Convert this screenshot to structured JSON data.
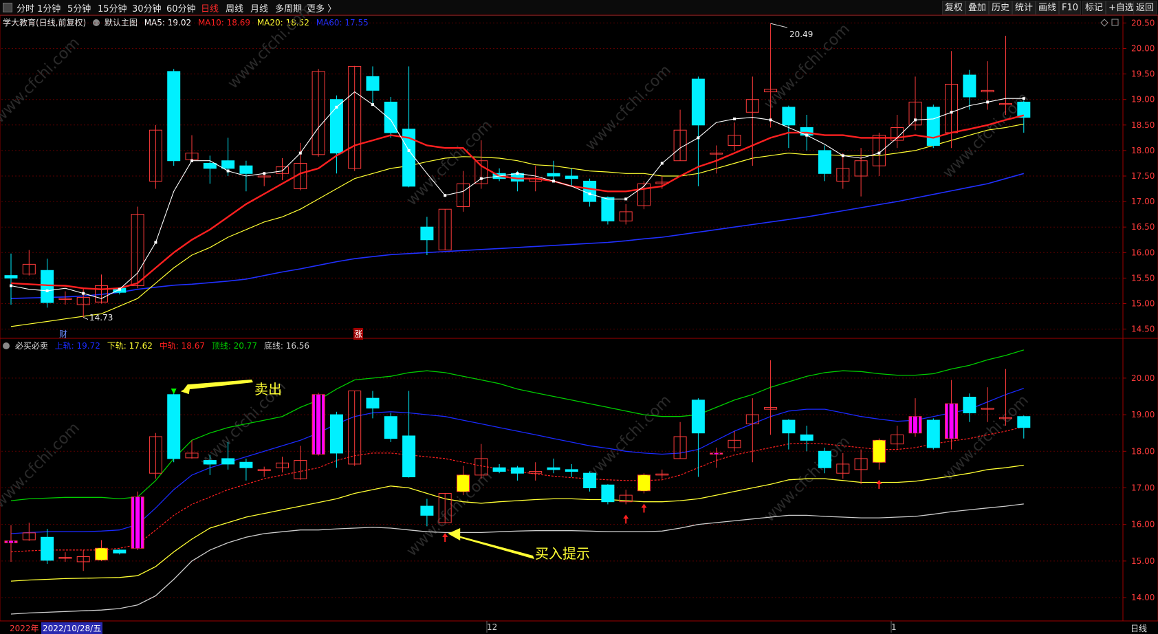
{
  "toolbar": {
    "periods": [
      "分时",
      "1分钟",
      "5分钟",
      "15分钟",
      "30分钟",
      "60分钟",
      "日线",
      "周线",
      "月线",
      "多周期",
      "更多 〉"
    ],
    "active_period": "日线",
    "buttons": [
      "复权",
      "叠加",
      "历史",
      "统计",
      "画线",
      "F10",
      "标记",
      "+自选",
      "返回"
    ]
  },
  "main_legend": {
    "stock": "学大教育(日线,前复权)",
    "template": "默认主图",
    "ma5": "MA5: 19.02",
    "ma10": "MA10: 18.69",
    "ma20": "MA20: 18.52",
    "ma60": "MA60: 17.55"
  },
  "indicator_legend": {
    "name": "必买必卖",
    "upper": "上轨: 19.72",
    "lower": "下轨: 17.62",
    "middle": "中轨: 18.67",
    "top": "顶线: 20.77",
    "bottom": "底线: 16.56"
  },
  "markers": {
    "cai": "财",
    "zhang": "涨",
    "high_label": "20.49",
    "low_label": "14.73"
  },
  "annotations": {
    "sell": "卖出",
    "buy": "买入提示"
  },
  "bottom_bar": {
    "year": "2022年",
    "date": "2022/10/28/五",
    "month12": "12",
    "month1": "1",
    "period_label": "日线"
  },
  "watermark": "www.cfchi.com",
  "colors": {
    "up": "#ff3b3b",
    "down": "#00f0ff",
    "ma5": "#ffffff",
    "ma10": "#ff2020",
    "ma20": "#ffff33",
    "ma60": "#2030ff",
    "band_top": "#00cc00",
    "band_upper": "#1a2aff",
    "band_mid": "#ff2020",
    "band_lower": "#ffff33",
    "band_bottom": "#cccccc",
    "buy_sell_pen": "#ff00ff",
    "highlight_up": "#ffff00",
    "annotation": "#ffff33"
  },
  "chart_data": [
    {
      "type": "candlestick",
      "title": "学大教育(日线,前复权)",
      "ylim": [
        14.4,
        20.6
      ],
      "y_ticks": [
        14.5,
        15.0,
        15.5,
        16.0,
        16.5,
        17.0,
        17.5,
        18.0,
        18.5,
        19.0,
        19.5,
        20.0,
        20.5
      ],
      "series_names": [
        "MA5",
        "MA10",
        "MA20",
        "MA60"
      ],
      "candles": [
        [
          15.55,
          15.5,
          15.98,
          14.98
        ],
        [
          15.58,
          15.77,
          16.05,
          15.55
        ],
        [
          15.65,
          15.02,
          15.88,
          14.92
        ],
        [
          15.08,
          15.1,
          15.24,
          14.98
        ],
        [
          14.98,
          15.12,
          15.3,
          14.73
        ],
        [
          15.03,
          15.35,
          15.57,
          15.0
        ],
        [
          15.3,
          15.22,
          15.32,
          15.18
        ],
        [
          15.35,
          16.75,
          16.9,
          15.3
        ],
        [
          17.4,
          18.4,
          18.5,
          17.25
        ],
        [
          19.55,
          17.8,
          19.6,
          17.7
        ],
        [
          17.82,
          17.95,
          18.3,
          17.8
        ],
        [
          17.75,
          17.65,
          17.9,
          17.35
        ],
        [
          17.8,
          17.65,
          18.25,
          17.5
        ],
        [
          17.7,
          17.55,
          17.8,
          17.2
        ],
        [
          17.48,
          17.5,
          17.58,
          17.3
        ],
        [
          17.55,
          17.68,
          17.85,
          17.42
        ],
        [
          17.25,
          17.75,
          18.15,
          17.22
        ],
        [
          17.92,
          19.55,
          19.6,
          17.88
        ],
        [
          19.0,
          17.95,
          19.08,
          17.55
        ],
        [
          17.65,
          19.65,
          19.66,
          17.6
        ],
        [
          19.45,
          19.18,
          19.65,
          18.9
        ],
        [
          18.95,
          18.35,
          19.05,
          18.25
        ],
        [
          18.42,
          17.3,
          19.65,
          17.28
        ],
        [
          16.5,
          16.25,
          16.7,
          15.95
        ],
        [
          16.05,
          16.85,
          16.85,
          16.05
        ],
        [
          16.9,
          17.35,
          17.6,
          16.8
        ],
        [
          17.35,
          17.8,
          18.2,
          17.25
        ],
        [
          17.55,
          17.45,
          17.65,
          17.4
        ],
        [
          17.55,
          17.4,
          17.6,
          17.2
        ],
        [
          17.4,
          17.45,
          17.7,
          17.2
        ],
        [
          17.55,
          17.5,
          17.8,
          17.4
        ],
        [
          17.5,
          17.45,
          17.65,
          17.3
        ],
        [
          17.4,
          17.0,
          17.45,
          16.9
        ],
        [
          17.08,
          16.62,
          17.1,
          16.55
        ],
        [
          16.62,
          16.8,
          16.95,
          16.55
        ],
        [
          16.92,
          17.35,
          17.4,
          16.85
        ],
        [
          17.35,
          17.38,
          17.5,
          17.25
        ],
        [
          17.8,
          18.4,
          18.8,
          17.8
        ],
        [
          19.4,
          18.5,
          19.45,
          17.3
        ],
        [
          17.95,
          17.95,
          18.1,
          17.55
        ],
        [
          18.1,
          18.3,
          18.55,
          18.0
        ],
        [
          18.75,
          19.0,
          19.45,
          17.7
        ],
        [
          19.15,
          19.2,
          20.49,
          18.45
        ],
        [
          18.85,
          18.5,
          18.88,
          18.05
        ],
        [
          18.45,
          18.3,
          18.7,
          18.0
        ],
        [
          18.0,
          17.55,
          18.1,
          17.4
        ],
        [
          17.4,
          17.65,
          17.95,
          17.25
        ],
        [
          17.5,
          17.8,
          18.05,
          17.1
        ],
        [
          17.7,
          18.3,
          18.35,
          17.5
        ],
        [
          18.2,
          18.45,
          18.7,
          18.05
        ],
        [
          18.5,
          18.95,
          19.45,
          18.4
        ],
        [
          18.85,
          18.1,
          18.9,
          18.05
        ],
        [
          18.35,
          19.3,
          19.95,
          18.05
        ],
        [
          19.48,
          19.05,
          19.58,
          18.8
        ],
        [
          19.15,
          19.18,
          19.75,
          18.8
        ],
        [
          18.92,
          18.92,
          20.25,
          18.7
        ],
        [
          18.95,
          18.65,
          18.98,
          18.35
        ]
      ],
      "ma5": [
        15.35,
        15.28,
        15.25,
        15.3,
        15.2,
        15.1,
        15.28,
        15.6,
        16.2,
        17.2,
        17.8,
        17.8,
        17.6,
        17.5,
        17.55,
        17.6,
        17.95,
        18.45,
        18.85,
        19.15,
        18.9,
        18.6,
        18.0,
        17.55,
        17.12,
        17.2,
        17.45,
        17.5,
        17.55,
        17.5,
        17.4,
        17.3,
        17.15,
        17.05,
        17.05,
        17.3,
        17.75,
        18.05,
        18.25,
        18.55,
        18.62,
        18.65,
        18.6,
        18.45,
        18.3,
        18.12,
        17.9,
        17.85,
        17.95,
        18.25,
        18.6,
        18.62,
        18.75,
        18.88,
        18.95,
        19.02,
        19.02
      ],
      "ma10": [
        15.4,
        15.38,
        15.36,
        15.35,
        15.3,
        15.28,
        15.3,
        15.4,
        15.7,
        16.0,
        16.25,
        16.45,
        16.7,
        16.95,
        17.15,
        17.35,
        17.55,
        17.65,
        17.9,
        18.1,
        18.2,
        18.3,
        18.25,
        18.1,
        18.05,
        18.05,
        17.7,
        17.5,
        17.45,
        17.45,
        17.4,
        17.3,
        17.25,
        17.2,
        17.2,
        17.25,
        17.3,
        17.5,
        17.68,
        17.8,
        17.95,
        18.1,
        18.25,
        18.35,
        18.35,
        18.3,
        18.3,
        18.25,
        18.25,
        18.25,
        18.3,
        18.25,
        18.35,
        18.42,
        18.5,
        18.6,
        18.69
      ],
      "ma20": [
        14.55,
        14.6,
        14.65,
        14.7,
        14.75,
        14.8,
        14.95,
        15.1,
        15.4,
        15.7,
        15.95,
        16.1,
        16.3,
        16.45,
        16.6,
        16.7,
        16.85,
        17.05,
        17.25,
        17.45,
        17.55,
        17.65,
        17.7,
        17.78,
        17.85,
        17.88,
        17.87,
        17.85,
        17.8,
        17.72,
        17.7,
        17.65,
        17.6,
        17.58,
        17.55,
        17.55,
        17.5,
        17.5,
        17.55,
        17.65,
        17.75,
        17.85,
        17.9,
        17.95,
        17.92,
        17.92,
        17.9,
        17.9,
        17.9,
        17.95,
        18.0,
        18.1,
        18.2,
        18.3,
        18.4,
        18.45,
        18.52
      ],
      "ma60": [
        15.1,
        15.11,
        15.12,
        15.13,
        15.15,
        15.18,
        15.22,
        15.28,
        15.32,
        15.36,
        15.38,
        15.41,
        15.44,
        15.48,
        15.55,
        15.62,
        15.68,
        15.75,
        15.82,
        15.88,
        15.92,
        15.96,
        15.98,
        16.0,
        16.02,
        16.04,
        16.06,
        16.08,
        16.1,
        16.12,
        16.14,
        16.16,
        16.18,
        16.2,
        16.23,
        16.27,
        16.3,
        16.35,
        16.4,
        16.45,
        16.5,
        16.55,
        16.6,
        16.65,
        16.7,
        16.76,
        16.82,
        16.88,
        16.94,
        17.0,
        17.07,
        17.14,
        17.21,
        17.28,
        17.35,
        17.45,
        17.55
      ]
    },
    {
      "type": "candlestick",
      "title": "必买必卖",
      "ylim": [
        13.4,
        20.9
      ],
      "y_ticks": [
        14.0,
        15.0,
        16.0,
        17.0,
        18.0,
        19.0,
        20.0
      ],
      "series_names": [
        "上轨",
        "下轨",
        "中轨",
        "顶线",
        "底线"
      ],
      "top": [
        16.65,
        16.7,
        16.72,
        16.74,
        16.74,
        16.74,
        16.7,
        16.75,
        17.2,
        17.8,
        18.3,
        18.5,
        18.65,
        18.75,
        18.85,
        18.95,
        19.2,
        19.4,
        19.7,
        19.95,
        20.0,
        20.05,
        20.15,
        20.2,
        20.15,
        20.05,
        19.95,
        19.85,
        19.7,
        19.6,
        19.5,
        19.4,
        19.3,
        19.2,
        19.1,
        19.0,
        18.95,
        18.95,
        19.0,
        19.2,
        19.4,
        19.55,
        19.75,
        19.9,
        20.05,
        20.15,
        20.2,
        20.18,
        20.12,
        20.08,
        20.08,
        20.12,
        20.25,
        20.35,
        20.5,
        20.62,
        20.77
      ],
      "upper": [
        15.75,
        15.78,
        15.8,
        15.8,
        15.8,
        15.82,
        15.85,
        16.0,
        16.45,
        16.95,
        17.35,
        17.55,
        17.7,
        17.85,
        18.0,
        18.15,
        18.3,
        18.5,
        18.75,
        18.95,
        19.05,
        19.08,
        19.05,
        19.0,
        18.95,
        18.85,
        18.75,
        18.65,
        18.55,
        18.45,
        18.35,
        18.25,
        18.15,
        18.08,
        18.0,
        17.95,
        17.92,
        17.95,
        18.05,
        18.3,
        18.55,
        18.75,
        18.95,
        19.1,
        19.15,
        19.15,
        19.05,
        18.95,
        18.88,
        18.82,
        18.85,
        18.95,
        19.05,
        19.15,
        19.35,
        19.55,
        19.72
      ],
      "middle": [
        15.25,
        15.28,
        15.3,
        15.3,
        15.3,
        15.3,
        15.35,
        15.45,
        15.85,
        16.25,
        16.55,
        16.75,
        16.95,
        17.1,
        17.25,
        17.35,
        17.45,
        17.55,
        17.75,
        17.88,
        17.95,
        17.95,
        17.9,
        17.85,
        17.8,
        17.7,
        17.6,
        17.52,
        17.45,
        17.38,
        17.32,
        17.28,
        17.25,
        17.22,
        17.2,
        17.2,
        17.22,
        17.35,
        17.55,
        17.75,
        17.9,
        18.0,
        18.1,
        18.2,
        18.22,
        18.2,
        18.15,
        18.1,
        18.05,
        18.05,
        18.1,
        18.2,
        18.28,
        18.35,
        18.45,
        18.55,
        18.67
      ],
      "lower": [
        14.45,
        14.48,
        14.5,
        14.52,
        14.53,
        14.54,
        14.55,
        14.6,
        14.85,
        15.25,
        15.6,
        15.9,
        16.05,
        16.2,
        16.3,
        16.4,
        16.5,
        16.6,
        16.7,
        16.85,
        16.95,
        17.05,
        17.0,
        16.85,
        16.7,
        16.62,
        16.58,
        16.62,
        16.65,
        16.68,
        16.7,
        16.7,
        16.68,
        16.68,
        16.65,
        16.62,
        16.62,
        16.65,
        16.7,
        16.8,
        16.9,
        17.0,
        17.1,
        17.22,
        17.25,
        17.25,
        17.2,
        17.15,
        17.15,
        17.15,
        17.18,
        17.25,
        17.32,
        17.4,
        17.5,
        17.55,
        17.62
      ],
      "bottom": [
        13.55,
        13.58,
        13.6,
        13.62,
        13.64,
        13.66,
        13.7,
        13.8,
        14.05,
        14.5,
        15.0,
        15.3,
        15.5,
        15.65,
        15.75,
        15.8,
        15.85,
        15.85,
        15.88,
        15.9,
        15.92,
        15.9,
        15.85,
        15.8,
        15.78,
        15.78,
        15.78,
        15.8,
        15.82,
        15.83,
        15.83,
        15.83,
        15.82,
        15.8,
        15.8,
        15.8,
        15.82,
        15.9,
        16.0,
        16.05,
        16.1,
        16.15,
        16.2,
        16.25,
        16.25,
        16.22,
        16.2,
        16.18,
        16.18,
        16.2,
        16.22,
        16.28,
        16.35,
        16.4,
        16.45,
        16.5,
        16.56
      ],
      "pen_bars": [
        0,
        7,
        17,
        39,
        50,
        52
      ],
      "yellow_bars": [
        5,
        25,
        35,
        48
      ],
      "sell_signal_index": 9,
      "buy_arrow_indices": [
        24,
        34,
        35,
        48
      ]
    }
  ]
}
